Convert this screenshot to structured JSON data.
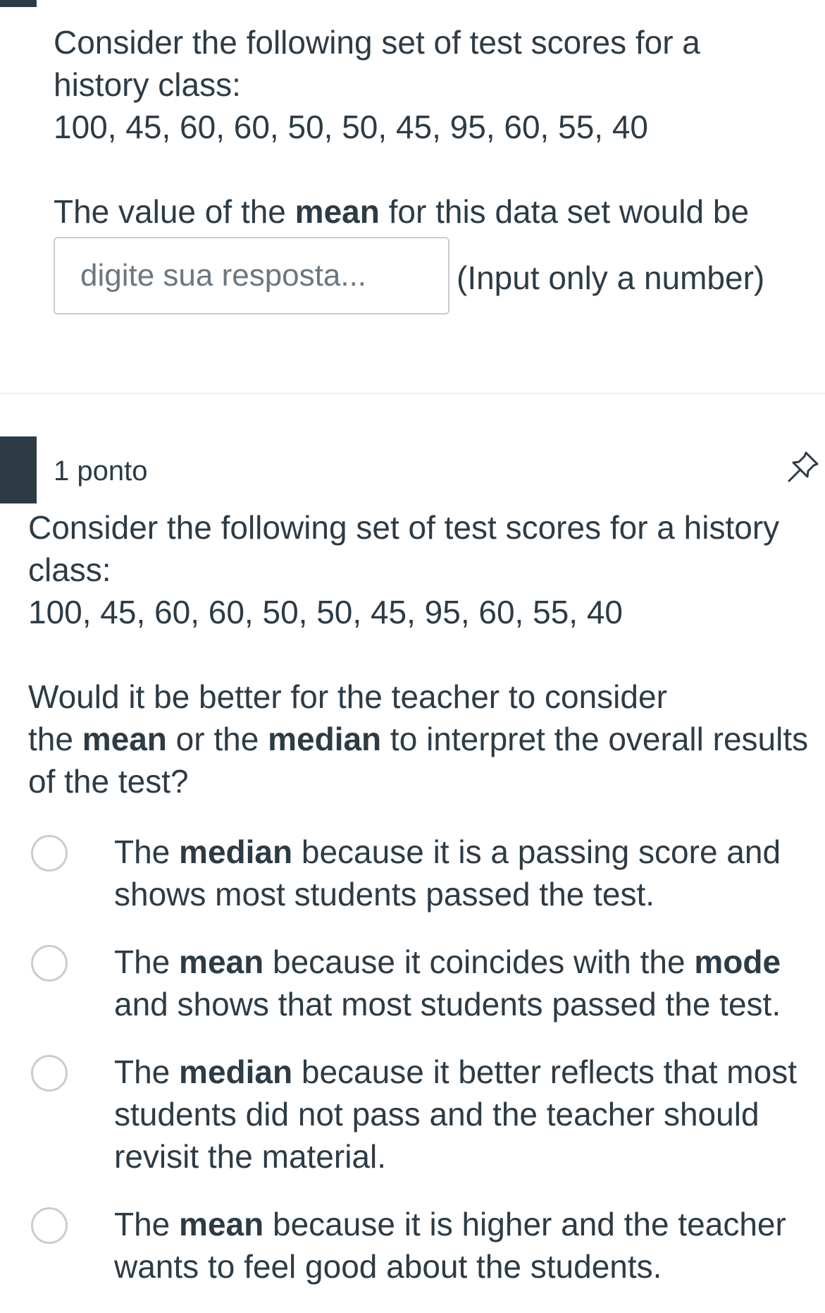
{
  "question1": {
    "intro_line1": "Consider the following set of test scores for a",
    "intro_line2": "history class:",
    "scores": "100, 45, 60, 60, 50, 50, 45, 95, 60, 55, 40",
    "prompt_before": "The value of the ",
    "prompt_bold": "mean",
    "prompt_after": " for this data set would be",
    "answer_placeholder": "digite sua resposta...",
    "answer_hint": "(Input only a number)"
  },
  "question2": {
    "points": "1 ponto",
    "pin_icon": "pin-icon",
    "intro_line1": "Consider the following set of test scores for a history",
    "intro_line2": "class:",
    "scores": "100, 45, 60, 60, 50, 50, 45, 95, 60, 55, 40",
    "prompt": {
      "line1": "Would it be better for the teacher to consider",
      "t1": "the ",
      "b1": "mean",
      "t2": " or the ",
      "b2": "median",
      "t3": " to interpret the overall results",
      "line3": "of the test?"
    },
    "options": [
      {
        "pre": "The ",
        "bold": "median",
        "post": " because it is a passing score and shows most students passed the test."
      },
      {
        "pre": "The ",
        "bold": "mean",
        "mid": " because it coincides with the ",
        "bold2": "mode",
        "post": " and shows that most students passed the test."
      },
      {
        "pre": "The ",
        "bold": "median",
        "post": " because it better reflects that most students did not pass and the teacher should revisit the material."
      },
      {
        "pre": "The ",
        "bold": "mean",
        "post": " because it is higher and the teacher wants to feel good about the students."
      }
    ]
  }
}
